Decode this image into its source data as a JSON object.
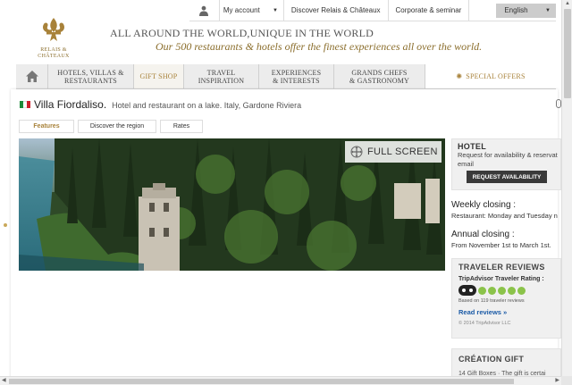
{
  "topbar": {
    "my_account": "My account",
    "discover": "Discover Relais & Châteaux",
    "corporate": "Corporate & seminar",
    "language": "English"
  },
  "logo": {
    "line1": "RELAIS &",
    "line2": "CHÂTEAUX"
  },
  "tagline": {
    "main": "ALL AROUND THE WORLD,UNIQUE IN THE WORLD",
    "sub": "Our 500 restaurants & hotels offer the finest experiences all over the world."
  },
  "nav": {
    "hotels": "HOTELS, VILLAS &\nRESTAURANTS",
    "gift": "GIFT SHOP",
    "travel": "TRAVEL\nINSPIRATION",
    "experiences": "EXPERIENCES\n& INTERESTS",
    "chefs": "GRANDS CHEFS\n& GASTRONOMY",
    "special": "SPECIAL OFFERS"
  },
  "hotel": {
    "name": "Villa Fiordaliso.",
    "description": "Hotel and restaurant on a lake. Italy, Gardone Riviera"
  },
  "tabs": {
    "features": "Features",
    "region": "Discover the region",
    "rates": "Rates"
  },
  "hero": {
    "fullscreen": "FULL SCREEN"
  },
  "sidebar": {
    "hotel_heading": "HOTEL",
    "hotel_text1": "Request for availability & reservat",
    "hotel_text2": "email",
    "request_button": "REQUEST AVAILABILITY",
    "weekly_heading": "Weekly closing :",
    "weekly_text": "Restaurant: Monday and Tuesday n",
    "annual_heading": "Annual closing :",
    "annual_text": "From November 1st to March 1st.",
    "reviews_heading": "TRAVELER REVIEWS",
    "reviews_rating_label": "TripAdvisor Traveler Rating :",
    "reviews_based": "Based on 119 traveler reviews",
    "reviews_link": "Read reviews »",
    "reviews_copy": "© 2014 TripAdvisor LLC",
    "creation_heading": "CRÉATION GIFT",
    "creation_text": "14 Gift Boxes · The gift is certai"
  },
  "colors": {
    "gold": "#a8823a",
    "nav_bg": "#ececec",
    "button_dark": "#3a3a3a",
    "link_blue": "#1a5aa6",
    "rating_green": "#8bc34a"
  },
  "icons": {
    "account": "person-icon",
    "dropdown": "chevron-down-icon",
    "home": "home-icon",
    "special": "sun-icon",
    "fullscreen": "expand-icon"
  }
}
